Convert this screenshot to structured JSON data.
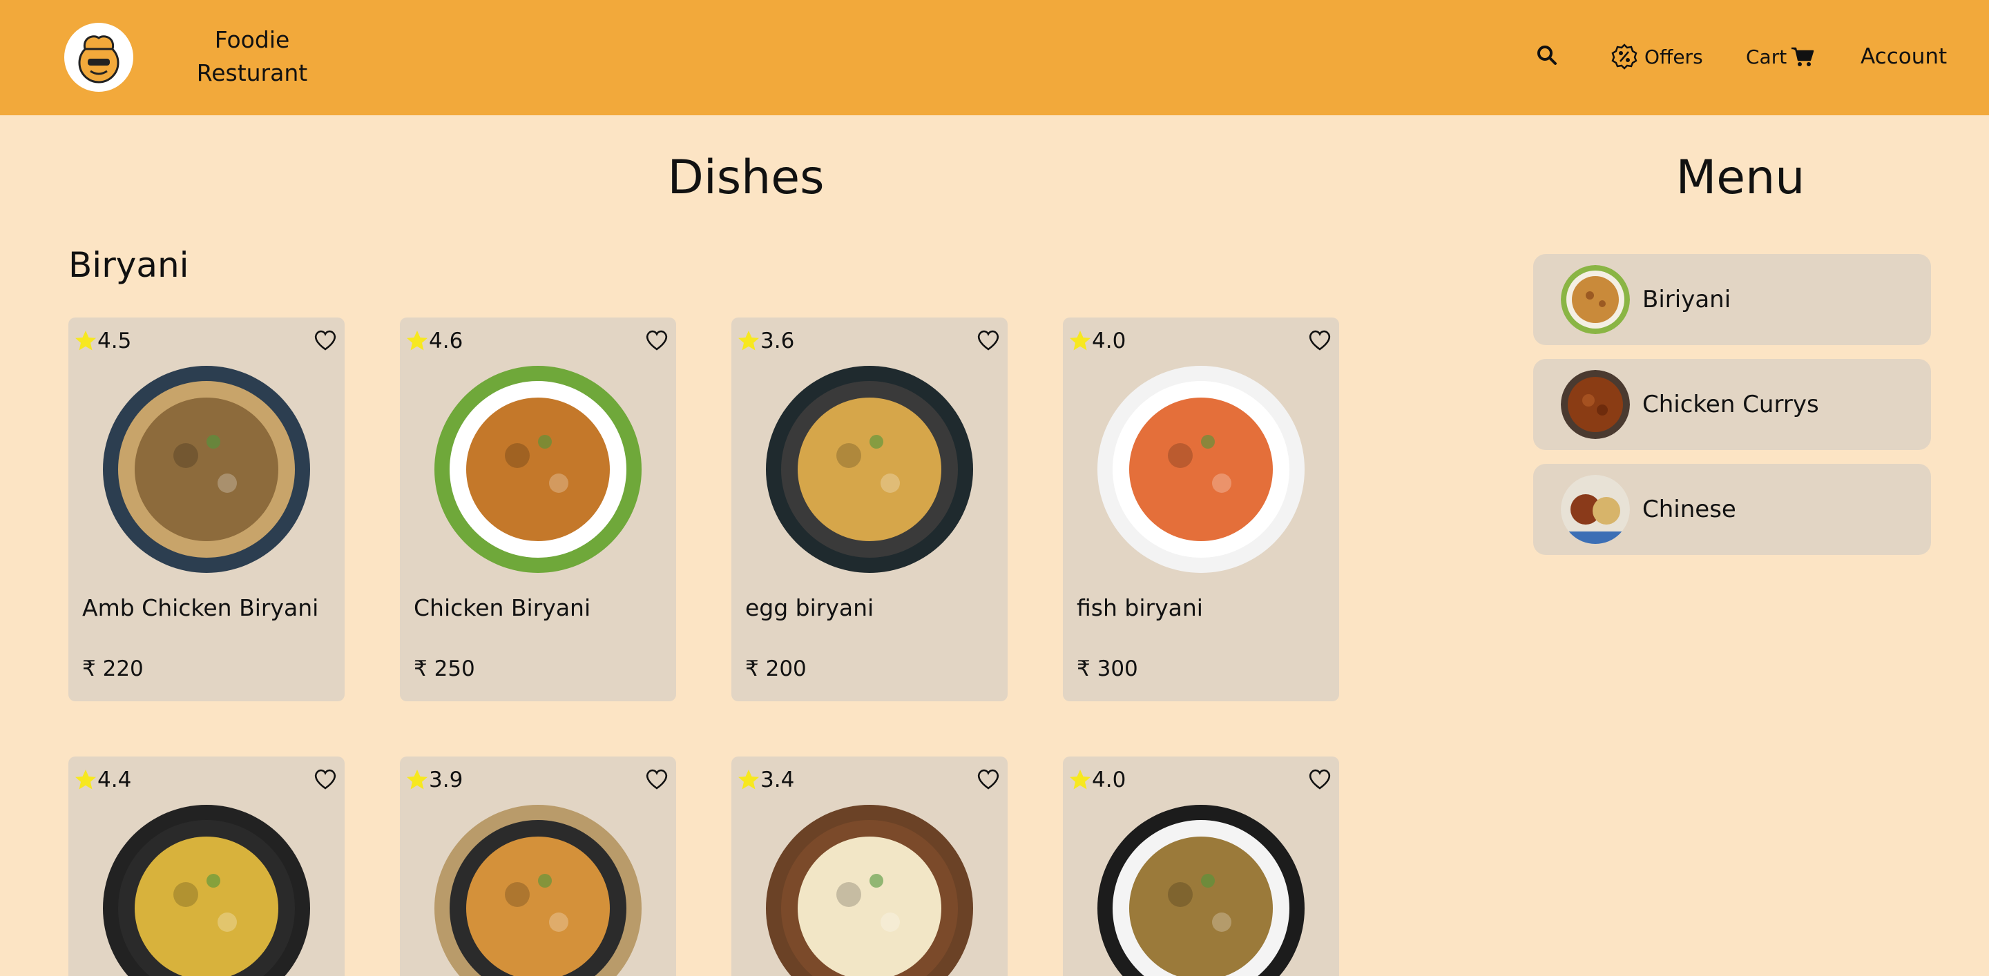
{
  "header": {
    "brand_line1": "Foodie",
    "brand_line2": "Resturant",
    "offers_label": "Offers",
    "cart_label": "Cart",
    "account_label": "Account",
    "colors": {
      "header_bg": "#f2a93b",
      "page_bg": "#fce4c4",
      "card_bg": "#e2d5c4",
      "star": "#f7e81f"
    }
  },
  "main": {
    "title": "Dishes",
    "section_title": "Biryani",
    "currency": "₹",
    "dishes": [
      {
        "rating": "4.5",
        "name": "Amb Chicken Biryani",
        "price": "220"
      },
      {
        "rating": "4.6",
        "name": "Chicken Biryani",
        "price": "250"
      },
      {
        "rating": "3.6",
        "name": "egg biryani",
        "price": "200"
      },
      {
        "rating": "4.0",
        "name": "fish biryani",
        "price": "300"
      },
      {
        "rating": "4.4"
      },
      {
        "rating": "3.9"
      },
      {
        "rating": "3.4"
      },
      {
        "rating": "4.0"
      }
    ]
  },
  "menu": {
    "title": "Menu",
    "items": [
      {
        "label": "Biriyani"
      },
      {
        "label": "Chicken Currys"
      },
      {
        "label": "Chinese"
      }
    ]
  }
}
